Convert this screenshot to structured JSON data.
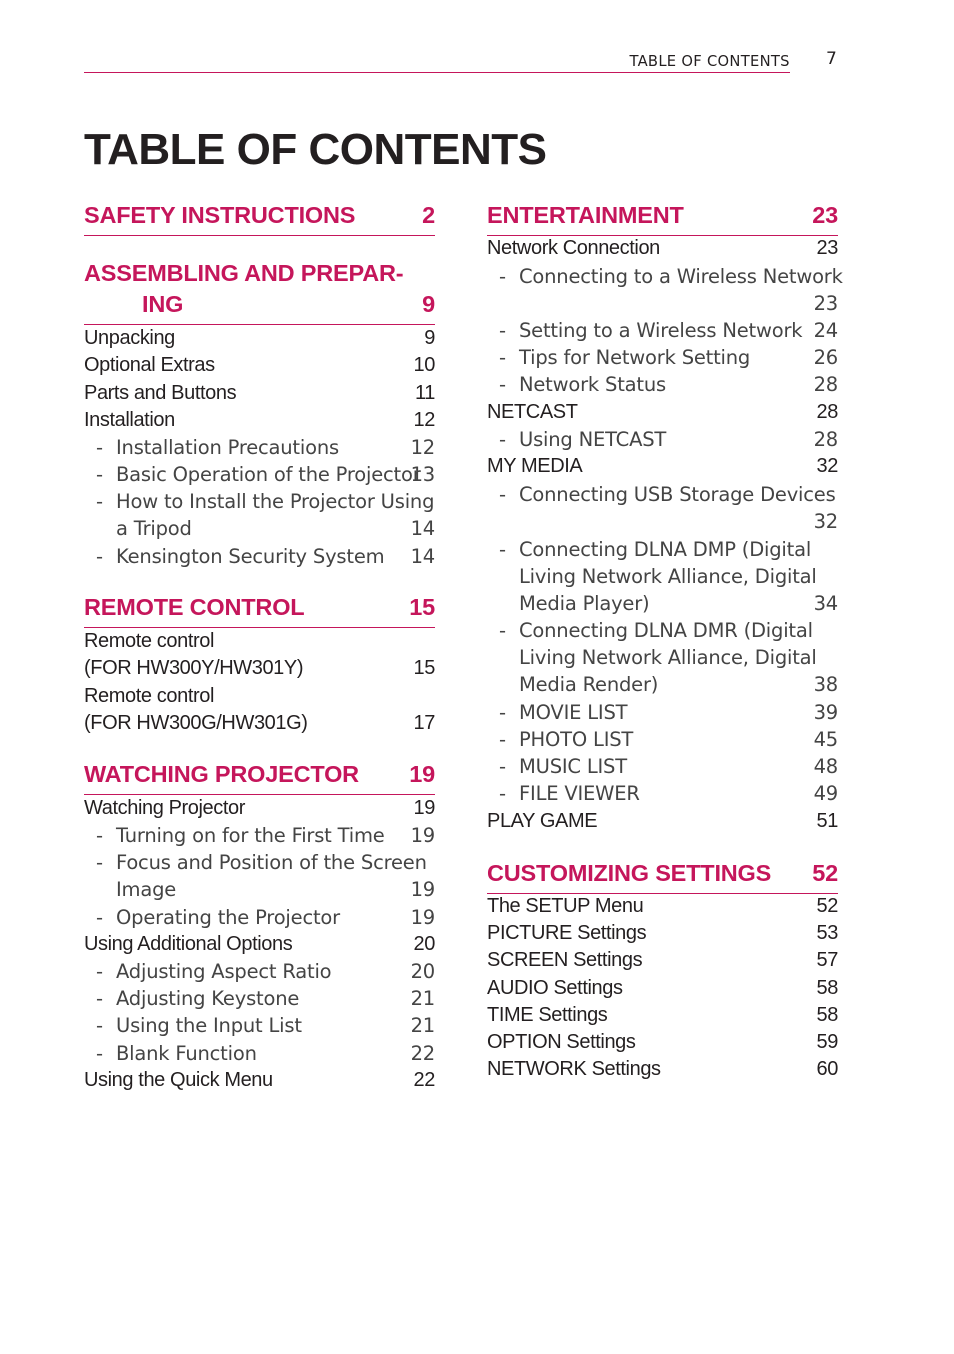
{
  "header": {
    "running_title": "TABLE OF CONTENTS",
    "page_number": "7",
    "accent_color": "#c5165b"
  },
  "title": "TABLE OF CONTENTS",
  "left_column": [
    {
      "type": "section",
      "lines": [
        "SAFETY INSTRUCTIONS"
      ],
      "page": "2"
    },
    {
      "type": "section",
      "lines": [
        "ASSEMBLING AND PREPAR-",
        "ING"
      ],
      "page": "9"
    },
    {
      "type": "main",
      "lines": [
        "Unpacking"
      ],
      "page": "9"
    },
    {
      "type": "main",
      "lines": [
        "Optional Extras"
      ],
      "page": "10"
    },
    {
      "type": "main",
      "lines": [
        "Parts and Buttons"
      ],
      "page": "11"
    },
    {
      "type": "main",
      "lines": [
        "Installation"
      ],
      "page": "12"
    },
    {
      "type": "sub",
      "lines": [
        "Installation Precautions"
      ],
      "page": "12"
    },
    {
      "type": "sub",
      "lines": [
        "Basic Operation of the Projector"
      ],
      "page": "13"
    },
    {
      "type": "sub",
      "lines": [
        "How to Install the Projector Using",
        "a Tripod"
      ],
      "page": "14"
    },
    {
      "type": "sub",
      "lines": [
        "Kensington Security System"
      ],
      "page": "14"
    },
    {
      "type": "section",
      "lines": [
        "REMOTE CONTROL"
      ],
      "page": "15"
    },
    {
      "type": "main",
      "lines": [
        "Remote control",
        "(FOR HW300Y/HW301Y)"
      ],
      "page": "15"
    },
    {
      "type": "main",
      "lines": [
        "Remote control",
        "(FOR HW300G/HW301G)"
      ],
      "page": "17"
    },
    {
      "type": "section",
      "lines": [
        "WATCHING PROJECTOR"
      ],
      "page": "19"
    },
    {
      "type": "main",
      "lines": [
        "Watching Projector"
      ],
      "page": "19"
    },
    {
      "type": "sub",
      "lines": [
        "Turning on for the First Time"
      ],
      "page": "19"
    },
    {
      "type": "sub",
      "lines": [
        "Focus and Position of the Screen",
        "Image"
      ],
      "page": "19"
    },
    {
      "type": "sub",
      "lines": [
        "Operating the Projector"
      ],
      "page": "19"
    },
    {
      "type": "main",
      "lines": [
        "Using Additional Options"
      ],
      "page": "20"
    },
    {
      "type": "sub",
      "lines": [
        "Adjusting Aspect Ratio"
      ],
      "page": "20"
    },
    {
      "type": "sub",
      "lines": [
        "Adjusting Keystone"
      ],
      "page": "21"
    },
    {
      "type": "sub",
      "lines": [
        "Using the Input List"
      ],
      "page": "21"
    },
    {
      "type": "sub",
      "lines": [
        "Blank Function"
      ],
      "page": "22"
    },
    {
      "type": "main",
      "lines": [
        "Using the Quick Menu"
      ],
      "page": "22"
    }
  ],
  "right_column": [
    {
      "type": "section",
      "lines": [
        "ENTERTAINMENT"
      ],
      "page": "23"
    },
    {
      "type": "main",
      "lines": [
        "Network Connection"
      ],
      "page": "23"
    },
    {
      "type": "sub",
      "lines": [
        "Connecting to a Wireless Network",
        ""
      ],
      "page": "23"
    },
    {
      "type": "sub",
      "lines": [
        "Setting to a Wireless Network"
      ],
      "page": "24"
    },
    {
      "type": "sub",
      "lines": [
        "Tips for Network Setting"
      ],
      "page": "26"
    },
    {
      "type": "sub",
      "lines": [
        "Network Status"
      ],
      "page": "28"
    },
    {
      "type": "main",
      "lines": [
        "NETCAST"
      ],
      "page": "28"
    },
    {
      "type": "sub",
      "lines": [
        "Using NETCAST"
      ],
      "page": "28"
    },
    {
      "type": "main",
      "lines": [
        "MY MEDIA"
      ],
      "page": "32"
    },
    {
      "type": "sub",
      "lines": [
        "Connecting USB Storage Devices",
        ""
      ],
      "page": "32"
    },
    {
      "type": "sub",
      "lines": [
        "Connecting DLNA DMP (Digital",
        "Living Network Alliance, Digital",
        "Media Player)"
      ],
      "page": "34"
    },
    {
      "type": "sub",
      "lines": [
        "Connecting DLNA DMR (Digital",
        "Living Network Alliance, Digital",
        "Media Render)"
      ],
      "page": "38"
    },
    {
      "type": "sub",
      "lines": [
        "MOVIE LIST"
      ],
      "page": "39"
    },
    {
      "type": "sub",
      "lines": [
        "PHOTO LIST"
      ],
      "page": "45"
    },
    {
      "type": "sub",
      "lines": [
        "MUSIC LIST"
      ],
      "page": "48"
    },
    {
      "type": "sub",
      "lines": [
        "FILE VIEWER"
      ],
      "page": "49"
    },
    {
      "type": "main",
      "lines": [
        "PLAY GAME"
      ],
      "page": "51"
    },
    {
      "type": "section",
      "lines": [
        "CUSTOMIZING SETTINGS"
      ],
      "page": "52"
    },
    {
      "type": "main",
      "lines": [
        "The SETUP Menu"
      ],
      "page": "52"
    },
    {
      "type": "main",
      "lines": [
        "PICTURE Settings"
      ],
      "page": "53"
    },
    {
      "type": "main",
      "lines": [
        "SCREEN Settings"
      ],
      "page": "57"
    },
    {
      "type": "main",
      "lines": [
        "AUDIO Settings"
      ],
      "page": "58"
    },
    {
      "type": "main",
      "lines": [
        "TIME Settings"
      ],
      "page": "58"
    },
    {
      "type": "main",
      "lines": [
        "OPTION Settings"
      ],
      "page": "59"
    },
    {
      "type": "main",
      "lines": [
        "NETWORK Settings"
      ],
      "page": "60"
    }
  ]
}
